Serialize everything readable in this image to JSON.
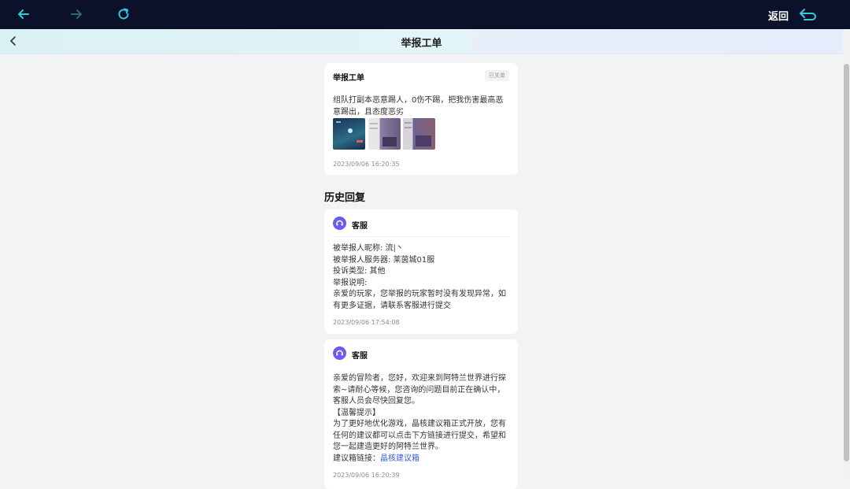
{
  "toolbar": {
    "return_label": "返回",
    "icons": [
      "arrow-left-icon",
      "arrow-right-icon",
      "reload-icon",
      "return-icon"
    ],
    "accent_color": "#33c7e0"
  },
  "header": {
    "title": "举报工单"
  },
  "ticket": {
    "title": "举报工单",
    "status": "已关单",
    "description": "组队打副本恶意踢人，0伤不踢，把我伤害最高恶意踢出，且态度恶劣",
    "time": "2023/09/06 16:20:35",
    "image_count": 3
  },
  "history": {
    "title": "历史回复",
    "replies": [
      {
        "agent": "客服",
        "lines": [
          "被举报人昵称: 流|丶",
          "被举报人服务器: 莱茵城01服",
          "投诉类型: 其他",
          "举报说明:",
          "亲爱的玩家，您举报的玩家暂时没有发现异常，如有更多证据，请联系客服进行提交"
        ],
        "time": "2023/09/06 17:54:08"
      },
      {
        "agent": "客服",
        "lines": [
          "亲爱的冒险者，您好，欢迎来到阿特兰世界进行探索~请耐心等候，您咨询的问题目前正在确认中，客服人员会尽快回复您。",
          "【温馨提示】",
          "为了更好地优化游戏，晶核建议箱正式开放，您有任何的建议都可以点击下方链接进行提交，希望和您一起建造更好的阿特兰世界。"
        ],
        "link_prefix": "建议箱链接：",
        "link_text": "晶核建议箱",
        "time": "2023/09/06 16:20:39"
      }
    ]
  }
}
